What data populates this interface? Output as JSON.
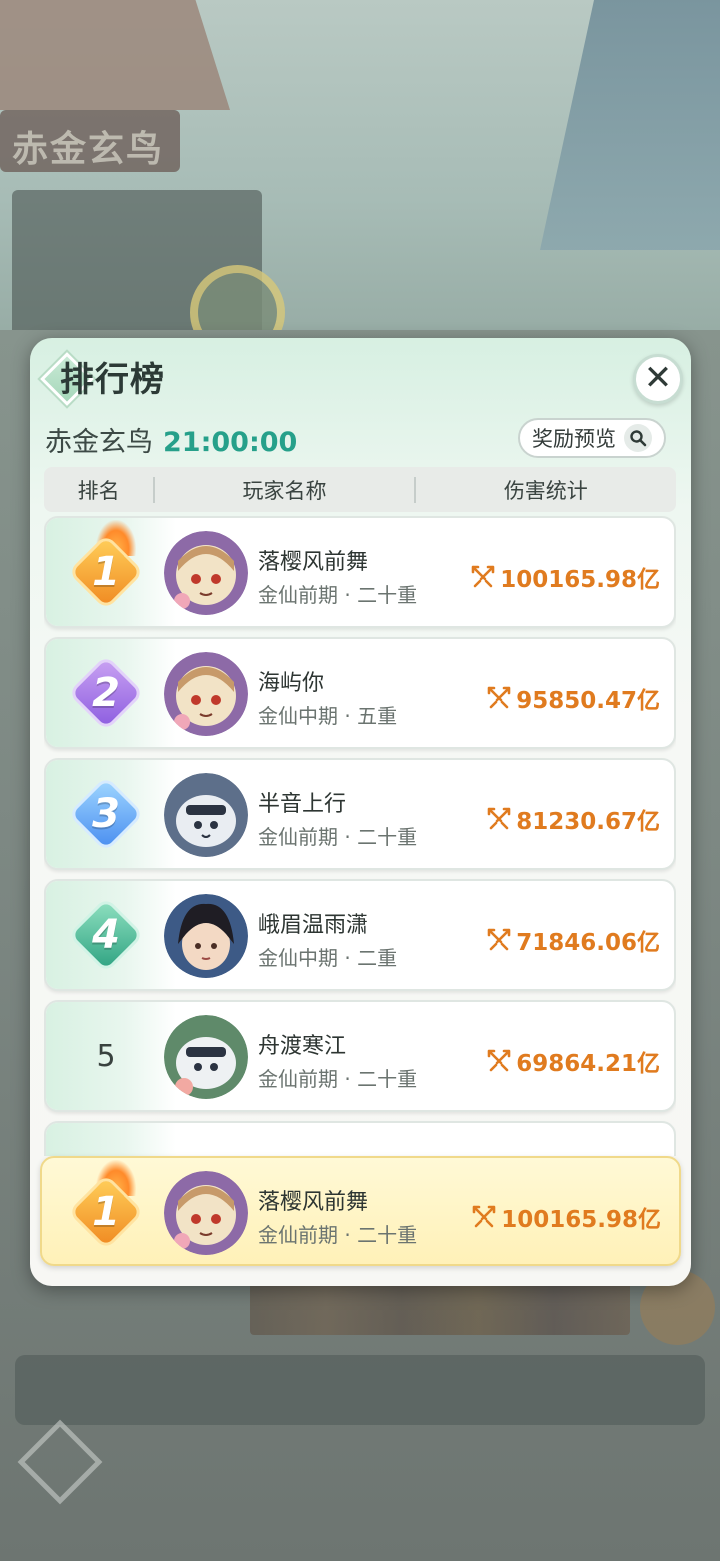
{
  "background": {
    "plaque_text": "赤金玄鸟"
  },
  "modal": {
    "title": "排行榜",
    "close_icon": "close-icon",
    "event_name": "赤金玄鸟",
    "event_time": "21:00:00",
    "reward_button": "奖励预览",
    "columns": {
      "rank": "排名",
      "player": "玩家名称",
      "damage": "伤害统计"
    }
  },
  "ranking": [
    {
      "rank": "1",
      "medal": "gold",
      "name": "落樱风前舞",
      "level": "金仙前期 · 二十重",
      "damage": "100165.98亿",
      "avatar": "girl"
    },
    {
      "rank": "2",
      "medal": "purple",
      "name": "海屿你",
      "level": "金仙中期 · 五重",
      "damage": "95850.47亿",
      "avatar": "girl"
    },
    {
      "rank": "3",
      "medal": "blue",
      "name": "半音上行",
      "level": "金仙前期 · 二十重",
      "damage": "81230.67亿",
      "avatar": "beast"
    },
    {
      "rank": "4",
      "medal": "green",
      "name": "峨眉温雨潇",
      "level": "金仙中期 · 二重",
      "damage": "71846.06亿",
      "avatar": "man"
    },
    {
      "rank": "5",
      "medal": "plain",
      "name": "舟渡寒江",
      "level": "金仙前期 · 二十重",
      "damage": "69864.21亿",
      "avatar": "beast"
    }
  ],
  "my_rank": {
    "rank": "1",
    "medal": "gold",
    "name": "落樱风前舞",
    "level": "金仙前期 · 二十重",
    "damage": "100165.98亿",
    "avatar": "girl"
  },
  "colors": {
    "accent_time": "#26a08a",
    "damage": "#e07b1f",
    "my_rank_bg": "#fff4c4"
  }
}
